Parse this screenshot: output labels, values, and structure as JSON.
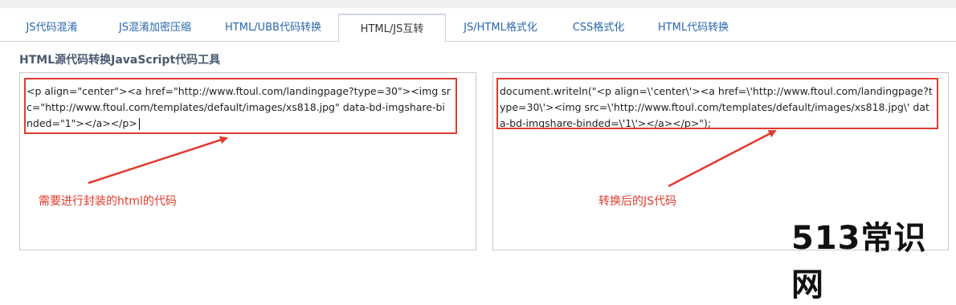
{
  "tabs": [
    {
      "label": "JS代码混淆",
      "active": false
    },
    {
      "label": "JS混淆加密压缩",
      "active": false
    },
    {
      "label": "HTML/UBB代码转换",
      "active": false
    },
    {
      "label": "HTML/JS互转",
      "active": true
    },
    {
      "label": "JS/HTML格式化",
      "active": false
    },
    {
      "label": "CSS格式化",
      "active": false
    },
    {
      "label": "HTML代码转换",
      "active": false
    }
  ],
  "heading": "HTML源代码转换JavaScript代码工具",
  "input_code": "<p align=\"center\"><a href=\"http://www.ftoul.com/landingpage?type=30\"><img src=\"http://www.ftoul.com/templates/default/images/xs818.jpg\" data-bd-imgshare-binded=\"1\"></a></p>",
  "output_code": "document.writeln(\"<p align=\\'center\\'><a href=\\'http://www.ftoul.com/landingpage?type=30\\'><img src=\\'http://www.ftoul.com/templates/default/images/xs818.jpg\\' data-bd-imgshare-binded=\\'1\\'></a></p>\");",
  "annotations": {
    "left": "需要进行封装的html的代码",
    "right": "转换后的JS代码"
  },
  "watermark": "513常识网",
  "colors": {
    "annotation": "#e23a2e",
    "tab_link": "#2a66b0",
    "heading": "#4a5a72"
  }
}
